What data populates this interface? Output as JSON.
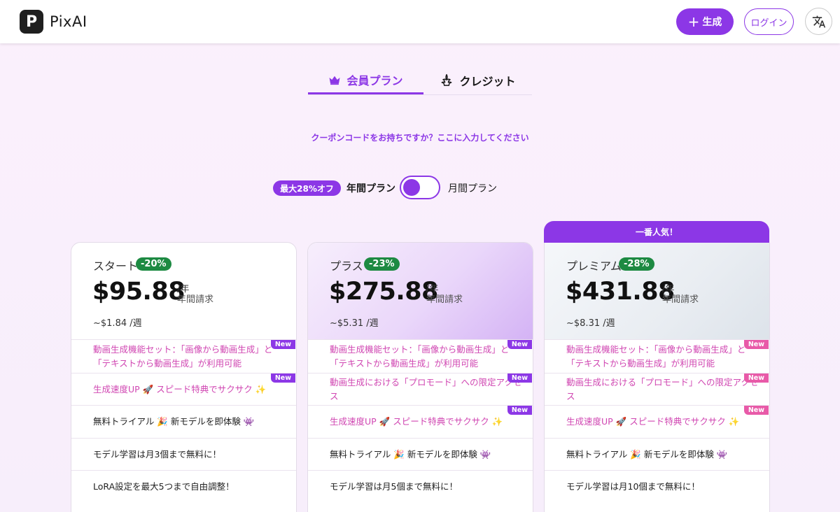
{
  "header": {
    "logo_letter": "P",
    "logo_text": "PixAI",
    "generate_label": "生成",
    "login_label": "ログイン"
  },
  "tabs": [
    {
      "label": "会員プラン",
      "icon": "crown-icon",
      "active": true
    },
    {
      "label": "クレジット",
      "icon": "credit-icon",
      "active": false
    }
  ],
  "coupon_text": "クーポンコードをお持ちですか？ここに入力してください",
  "billing_toggle": {
    "discount_badge": "最大28%オフ",
    "annual_label": "年間プラン",
    "monthly_label": "月間プラン",
    "selected": "annual"
  },
  "popular_banner": "一番人気！",
  "plans": [
    {
      "name": "スタート",
      "discount": "-20%",
      "price": "$95.88",
      "per": "/年",
      "billing": "年間請求",
      "weekly": "~$1.84 /週",
      "features": [
        {
          "text": "動画生成機能セット：「画像から動画生成」と「テキストから動画生成」が利用可能",
          "new": "New",
          "pink": true
        },
        {
          "text": "生成速度UP 🚀 スピード特典でサクサク ✨",
          "new": "New",
          "pink": true
        },
        {
          "text": "無料トライアル 🎉 新モデルを即体験 👾",
          "new": "",
          "pink": false
        },
        {
          "text": "モデル学習は月3個まで無料に！",
          "new": "",
          "pink": false
        },
        {
          "text": "LoRA設定を最大5つまで自由調整！",
          "new": "",
          "pink": false
        }
      ]
    },
    {
      "name": "プラス",
      "discount": "-23%",
      "price": "$275.88",
      "per": "/年",
      "billing": "年間請求",
      "weekly": "~$5.31 /週",
      "features": [
        {
          "text": "動画生成機能セット：「画像から動画生成」と「テキストから動画生成」が利用可能",
          "new": "New",
          "pink": true
        },
        {
          "text": "動画生成における「プロモード」への限定アクセス",
          "new": "New",
          "pink": true
        },
        {
          "text": "生成速度UP 🚀 スピード特典でサクサク ✨",
          "new": "New",
          "pink": true
        },
        {
          "text": "無料トライアル 🎉 新モデルを即体験 👾",
          "new": "",
          "pink": false
        },
        {
          "text": "モデル学習は月5個まで無料に！",
          "new": "",
          "pink": false
        }
      ]
    },
    {
      "name": "プレミアム",
      "discount": "-28%",
      "price": "$431.88",
      "per": "/年",
      "billing": "年間請求",
      "weekly": "~$8.31 /週",
      "features": [
        {
          "text": "動画生成機能セット：「画像から動画生成」と「テキストから動画生成」が利用可能",
          "new": "New",
          "pink": true
        },
        {
          "text": "動画生成における「プロモード」への限定アクセス",
          "new": "New",
          "pink": true
        },
        {
          "text": "生成速度UP 🚀 スピード特典でサクサク ✨",
          "new": "New",
          "pink": true
        },
        {
          "text": "無料トライアル 🎉 新モデルを即体験 👾",
          "new": "",
          "pink": false
        },
        {
          "text": "モデル学習は月10個まで無料に！",
          "new": "",
          "pink": false
        }
      ]
    }
  ],
  "colors": {
    "accent": "#8c37e6",
    "discount_green": "#1d8a42",
    "feature_pink": "#d046b2",
    "new_tag_pink": "#e85aa8"
  }
}
